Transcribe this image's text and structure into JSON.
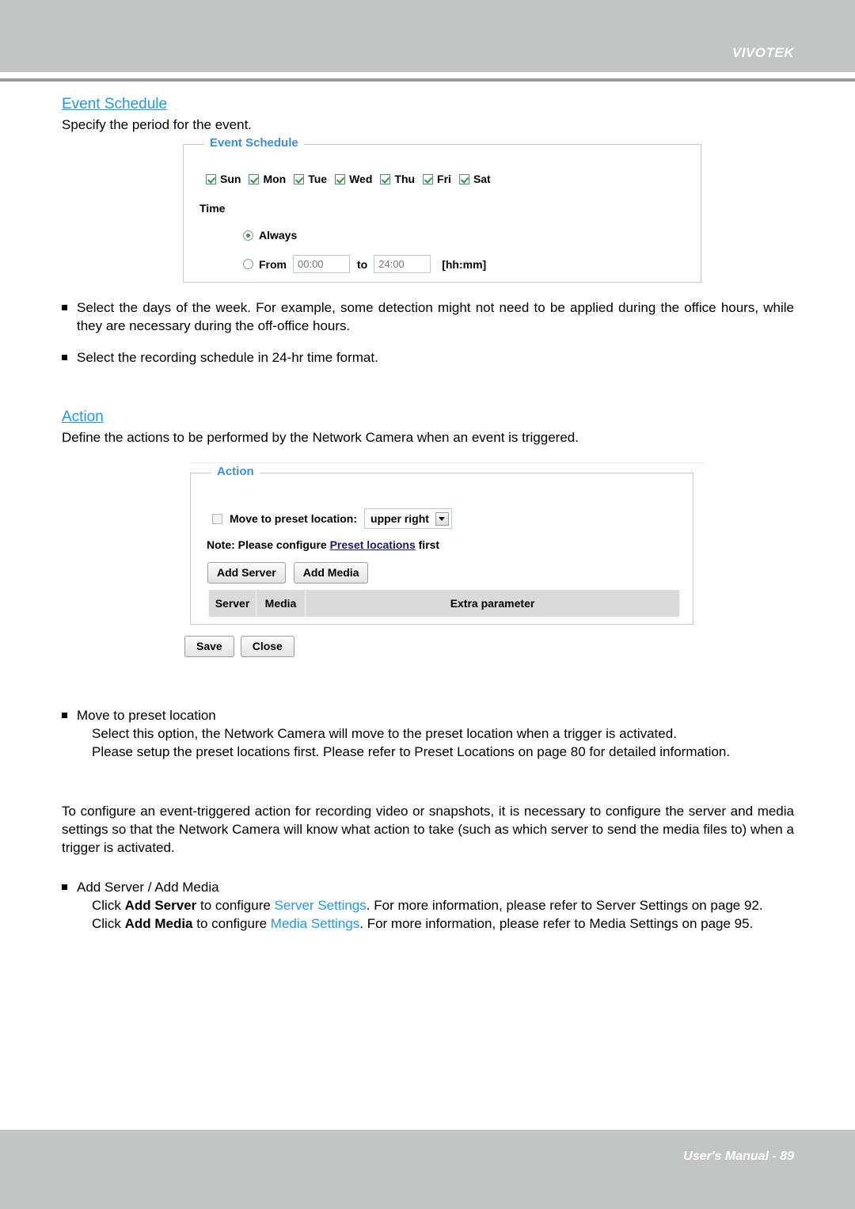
{
  "header": {
    "brand": "VIVOTEK"
  },
  "footer": {
    "text": "User's Manual - 89"
  },
  "event_schedule_section": {
    "heading": "Event Schedule",
    "intro": "Specify the period for the event.",
    "panel": {
      "legend": "Event Schedule",
      "days": [
        {
          "label": "Sun",
          "checked": true
        },
        {
          "label": "Mon",
          "checked": true
        },
        {
          "label": "Tue",
          "checked": true
        },
        {
          "label": "Wed",
          "checked": true
        },
        {
          "label": "Thu",
          "checked": true
        },
        {
          "label": "Fri",
          "checked": true
        },
        {
          "label": "Sat",
          "checked": true
        }
      ],
      "time_label": "Time",
      "always_label": "Always",
      "always_selected": true,
      "from_label": "From",
      "from_value": "00:00",
      "to_word": "to",
      "to_value": "24:00",
      "format_hint": "[hh:mm]"
    },
    "bullets": [
      "Select the days of the week. For example, some detection might not need to be applied during the office hours, while they are necessary during the off-office hours.",
      "Select the recording schedule in 24-hr time format."
    ]
  },
  "action_section": {
    "heading": "Action",
    "intro": "Define the actions to be performed by the Network Camera when an event is triggered.",
    "panel": {
      "legend": "Action",
      "preset_checkbox_label": "Move to preset location:",
      "preset_checked": false,
      "preset_selected_option": "upper right",
      "note_prefix": "Note: Please configure ",
      "note_link": "Preset locations",
      "note_suffix": " first",
      "add_server_label": "Add Server",
      "add_media_label": "Add Media",
      "table_headers": [
        "Server",
        "Media",
        "Extra parameter"
      ]
    },
    "save_label": "Save",
    "close_label": "Close"
  },
  "notes": {
    "move_bullet_title": "Move to preset location",
    "move_bullet_line1": "Select this option, the Network Camera will move to the preset location when a trigger is activated.",
    "move_bullet_line2": "Please setup the preset locations first. Please refer to Preset Locations on page 80 for detailed information.",
    "configure_paragraph": "To configure an event-triggered action for recording video or snapshots, it is necessary to configure the server and media settings so that the Network Camera will know what action to take (such as which server to send the media files to) when a trigger is activated.",
    "add_bullet_title": "Add Server / Add Media",
    "add_server_click": "Click ",
    "add_server_bold": "Add Server",
    "add_server_mid": " to configure ",
    "add_server_link": "Server Settings",
    "add_server_tail": ". For more information, please refer to Server Settings on page 92.",
    "add_media_click": "Click ",
    "add_media_bold": "Add Media",
    "add_media_mid": " to configure ",
    "add_media_link": "Media Settings",
    "add_media_tail": ". For more information, please refer to Media Settings on page 95."
  }
}
